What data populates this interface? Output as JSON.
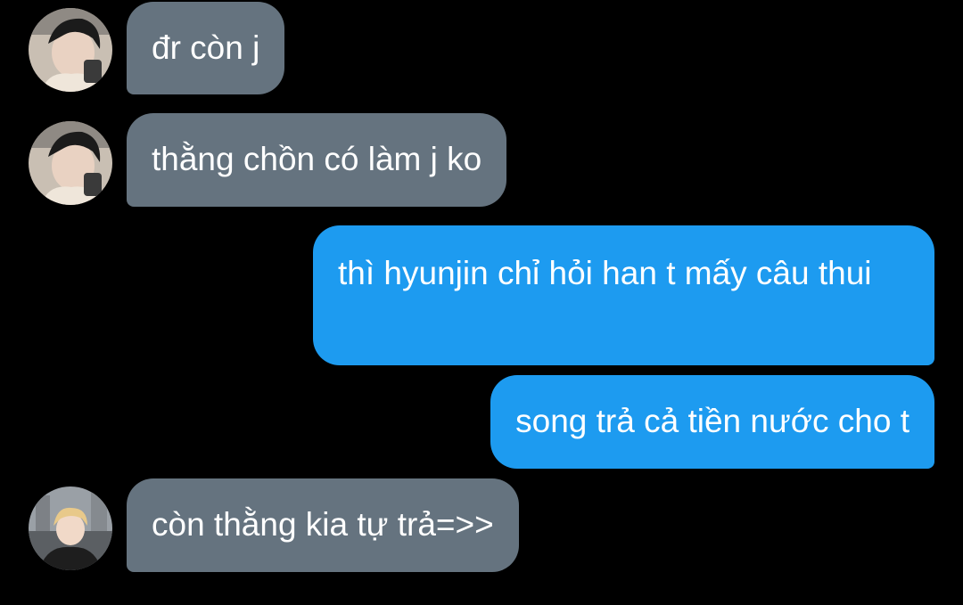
{
  "messages": [
    {
      "direction": "incoming",
      "sender_avatar": "avatar-photo-1",
      "text": "đr còn j"
    },
    {
      "direction": "incoming",
      "sender_avatar": "avatar-photo-1",
      "text": "thằng chồn có làm j ko"
    },
    {
      "direction": "outgoing",
      "text": "thì hyunjin chỉ hỏi han t mấy câu thui"
    },
    {
      "direction": "outgoing",
      "text": "song trả cả tiền nước cho t"
    },
    {
      "direction": "incoming",
      "sender_avatar": "avatar-photo-2",
      "text": "còn thằng kia tự trả=>>"
    }
  ],
  "colors": {
    "background": "#000000",
    "incoming_bubble": "#65737f",
    "outgoing_bubble": "#1d9bf0",
    "text": "#ffffff"
  }
}
